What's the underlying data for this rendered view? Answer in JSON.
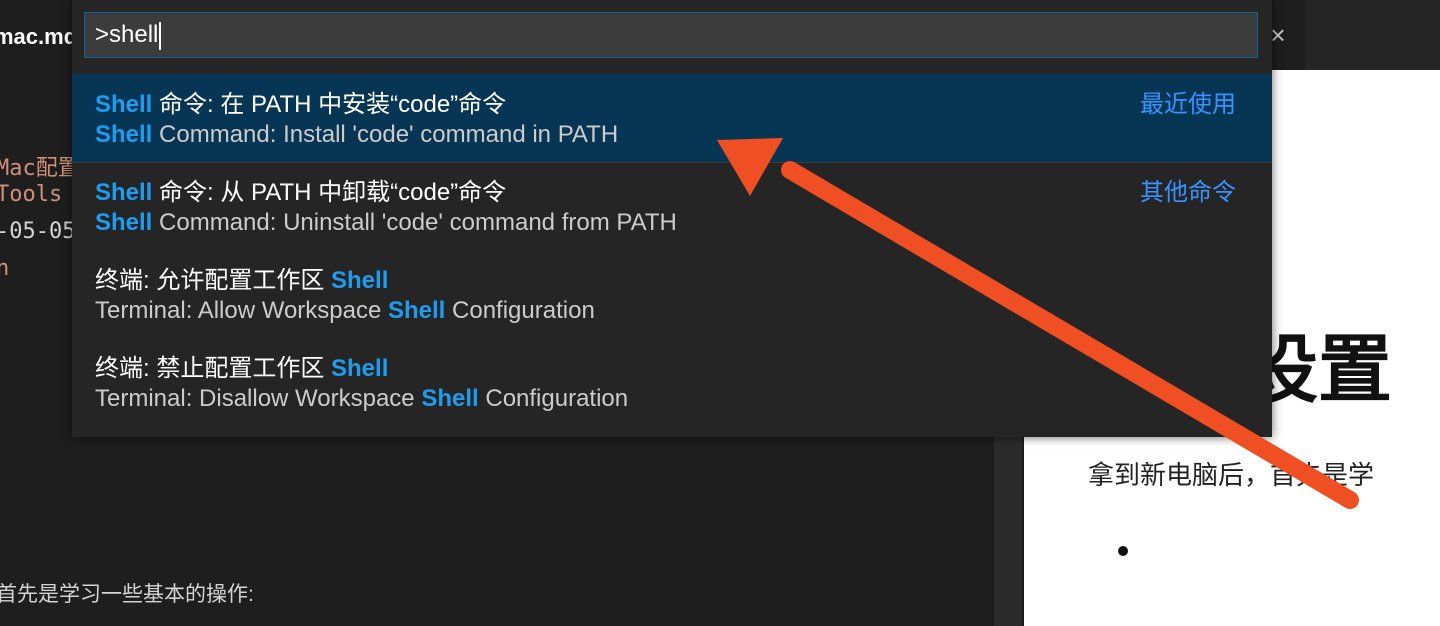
{
  "editor": {
    "tab_title": "mac.md",
    "lines": [
      "Mac配置",
      "Tools",
      "-05-05",
      "n"
    ],
    "bottom_text": "首先是学习一些基本的操作:"
  },
  "preview": {
    "heading": "设置",
    "paragraph": "拿到新电脑后，首先是学"
  },
  "palette": {
    "input_value": ">shell",
    "items": [
      {
        "l1_hl": "Shell",
        "l1_rest": " 命令: 在 PATH 中安装“code”命令",
        "l2_hl": "Shell",
        "l2_rest": " Command: Install 'code' command in PATH",
        "tag": "最近使用"
      },
      {
        "l1_hl": "Shell",
        "l1_rest": " 命令: 从 PATH 中卸载“code”命令",
        "l2_hl": "Shell",
        "l2_rest": " Command: Uninstall 'code' command from PATH",
        "tag": "其他命令"
      },
      {
        "l1_pre": "终端: 允许配置工作区 ",
        "l1_hl": "Shell",
        "l2_pre": "Terminal: Allow Workspace ",
        "l2_hl": "Shell",
        "l2_rest": " Configuration"
      },
      {
        "l1_pre": "终端: 禁止配置工作区 ",
        "l1_hl": "Shell",
        "l2_pre": "Terminal: Disallow Workspace ",
        "l2_hl": "Shell",
        "l2_rest": " Configuration"
      }
    ]
  },
  "colors": {
    "highlight": "#1e9cf0",
    "active_row": "#073655",
    "arrow": "#f04e23"
  },
  "icons": {
    "close": "close-icon"
  }
}
